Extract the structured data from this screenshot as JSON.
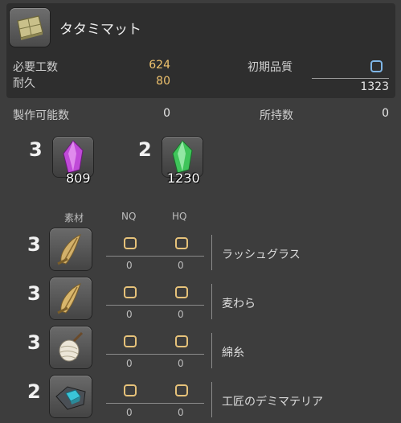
{
  "item": {
    "name": "タタミマット",
    "icon": "tatami-mat-icon"
  },
  "stats": {
    "required_work_label": "必要工数",
    "required_work_value": "624",
    "durability_label": "耐久",
    "durability_value": "80",
    "initial_quality_label": "初期品質",
    "quality_max": "1323",
    "craftable_label": "製作可能数",
    "craftable_value": "0",
    "owned_label": "所持数",
    "owned_value": "0"
  },
  "crystals": [
    {
      "count": "3",
      "owned": "809",
      "icon": "lightning-crystal-icon",
      "color": "#c04ad8"
    },
    {
      "count": "2",
      "owned": "1230",
      "icon": "wind-crystal-icon",
      "color": "#3fc45a"
    }
  ],
  "materials_header": {
    "material": "素材",
    "nq": "NQ",
    "hq": "HQ"
  },
  "materials": [
    {
      "count": "3",
      "name": "ラッシュグラス",
      "nq": "0",
      "hq": "0",
      "icon": "rush-grass-icon"
    },
    {
      "count": "3",
      "name": "麦わら",
      "nq": "0",
      "hq": "0",
      "icon": "straw-icon"
    },
    {
      "count": "3",
      "name": "綿糸",
      "nq": "0",
      "hq": "0",
      "icon": "cotton-yarn-icon"
    },
    {
      "count": "2",
      "name": "工匠のデミマテリア",
      "nq": "0",
      "hq": "0",
      "icon": "demimateria-icon"
    }
  ],
  "colors": {
    "accent_gold": "#e6c27a",
    "hq_blue": "#7fb6e6"
  }
}
